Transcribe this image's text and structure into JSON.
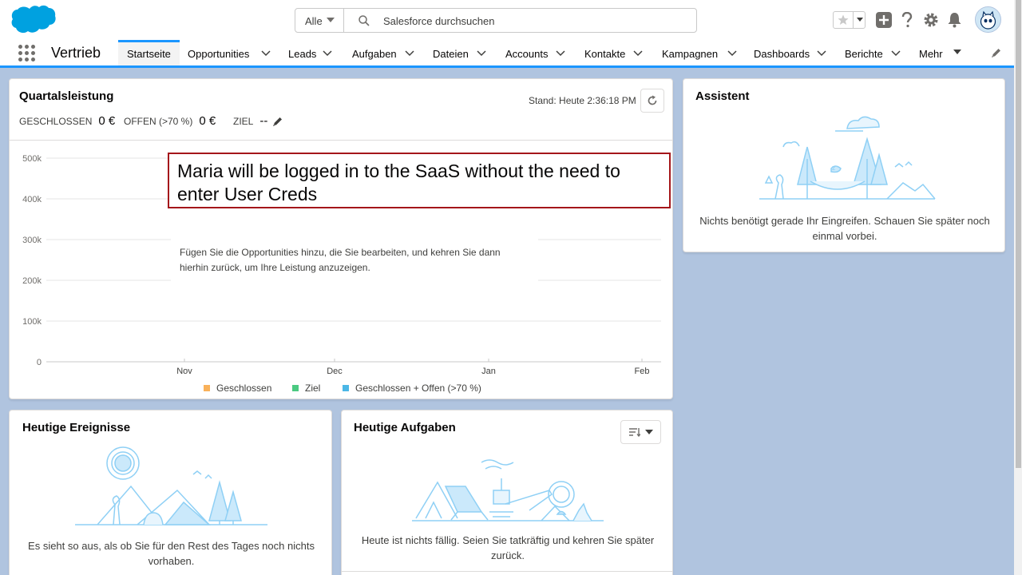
{
  "header": {
    "search_scope": "Alle",
    "search_placeholder": "Salesforce durchsuchen",
    "icons": [
      "salesforce-logo",
      "star-icon",
      "plus-icon",
      "help-icon",
      "gear-icon",
      "bell-icon",
      "avatar"
    ]
  },
  "nav": {
    "app_name": "Vertrieb",
    "items": [
      {
        "label": "Startseite"
      },
      {
        "label": "Opportunities"
      },
      {
        "label": "Leads"
      },
      {
        "label": "Aufgaben"
      },
      {
        "label": "Dateien"
      },
      {
        "label": "Accounts"
      },
      {
        "label": "Kontakte"
      },
      {
        "label": "Kampagnen"
      },
      {
        "label": "Dashboards"
      },
      {
        "label": "Berichte"
      },
      {
        "label": "Mehr"
      }
    ]
  },
  "quarter": {
    "title": "Quartalsleistung",
    "timestamp": "Stand: Heute 2:36:18 PM",
    "closed_label": "GESCHLOSSEN",
    "closed_value": "0 €",
    "open_label": "OFFEN (>70 %)",
    "open_value": "0 €",
    "goal_label": "ZIEL",
    "goal_value": "--",
    "empty_message": "Fügen Sie die Opportunities hinzu, die Sie bearbeiten, und kehren Sie dann hierhin zurück, um Ihre Leistung anzuzeigen."
  },
  "chart_data": {
    "type": "line",
    "title": "",
    "y_ticks": [
      "500k",
      "400k",
      "300k",
      "200k",
      "100k",
      "0"
    ],
    "categories": [
      "Nov",
      "Dec",
      "Jan",
      "Feb"
    ],
    "ylim": [
      0,
      500000
    ],
    "grid": true,
    "series": [
      {
        "name": "Geschlossen",
        "color": "#f9b15a",
        "values": []
      },
      {
        "name": "Ziel",
        "color": "#4bca81",
        "values": []
      },
      {
        "name": "Geschlossen + Offen (>70 %)",
        "color": "#4bb7e6",
        "values": []
      }
    ],
    "legend_position": "bottom"
  },
  "annotation": {
    "text": "Maria will be logged in to the SaaS without the need to enter User Creds",
    "border_color": "#a4161a"
  },
  "assistant": {
    "title": "Assistent",
    "message": "Nichts benötigt gerade Ihr Eingreifen. Schauen Sie später noch einmal vorbei."
  },
  "events": {
    "title": "Heutige Ereignisse",
    "message": "Es sieht so aus, als ob Sie für den Rest des Tages noch nichts vorhaben."
  },
  "tasks": {
    "title": "Heutige Aufgaben",
    "message": "Heute ist nichts fällig. Seien Sie tatkräftig und kehren Sie später zurück."
  },
  "colors": {
    "brand_blue": "#1b96ff",
    "page_background": "#b0c4df",
    "illustration": "#8fd0f5"
  }
}
